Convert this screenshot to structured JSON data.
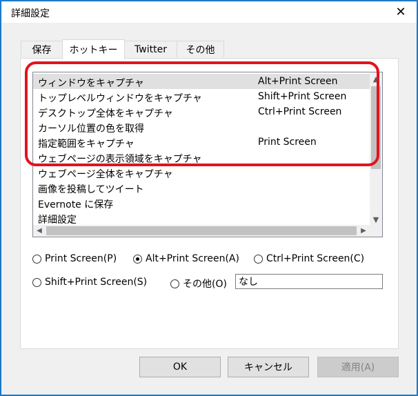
{
  "window": {
    "title": "詳細設定"
  },
  "tabs": [
    {
      "label": "保存"
    },
    {
      "label": "ホットキー"
    },
    {
      "label": "Twitter"
    },
    {
      "label": "その他"
    }
  ],
  "hotkeys": [
    {
      "name": "ウィンドウをキャプチャ",
      "key": "Alt+Print Screen"
    },
    {
      "name": "トップレベルウィンドウをキャプチャ",
      "key": "Shift+Print Screen"
    },
    {
      "name": "デスクトップ全体をキャプチャ",
      "key": "Ctrl+Print Screen"
    },
    {
      "name": "カーソル位置の色を取得",
      "key": ""
    },
    {
      "name": "指定範囲をキャプチャ",
      "key": "Print Screen"
    },
    {
      "name": "ウェブページの表示領域をキャプチャ",
      "key": ""
    },
    {
      "name": "ウェブページ全体をキャプチャ",
      "key": ""
    },
    {
      "name": "画像を投稿してツイート",
      "key": ""
    },
    {
      "name": "Evernote に保存",
      "key": ""
    },
    {
      "name": "詳細設定",
      "key": ""
    }
  ],
  "options": [
    {
      "label": "Print Screen(P)",
      "checked": false
    },
    {
      "label": "Alt+Print Screen(A)",
      "checked": true
    },
    {
      "label": "Ctrl+Print Screen(C)",
      "checked": false
    },
    {
      "label": "Shift+Print Screen(S)",
      "checked": false
    },
    {
      "label": "その他(O)",
      "checked": false
    }
  ],
  "other_value": "なし",
  "buttons": {
    "ok": "OK",
    "cancel": "キャンセル",
    "apply": "適用(A)"
  },
  "colors": {
    "highlight": "#e0141e",
    "accent": "#1c7fd0"
  }
}
